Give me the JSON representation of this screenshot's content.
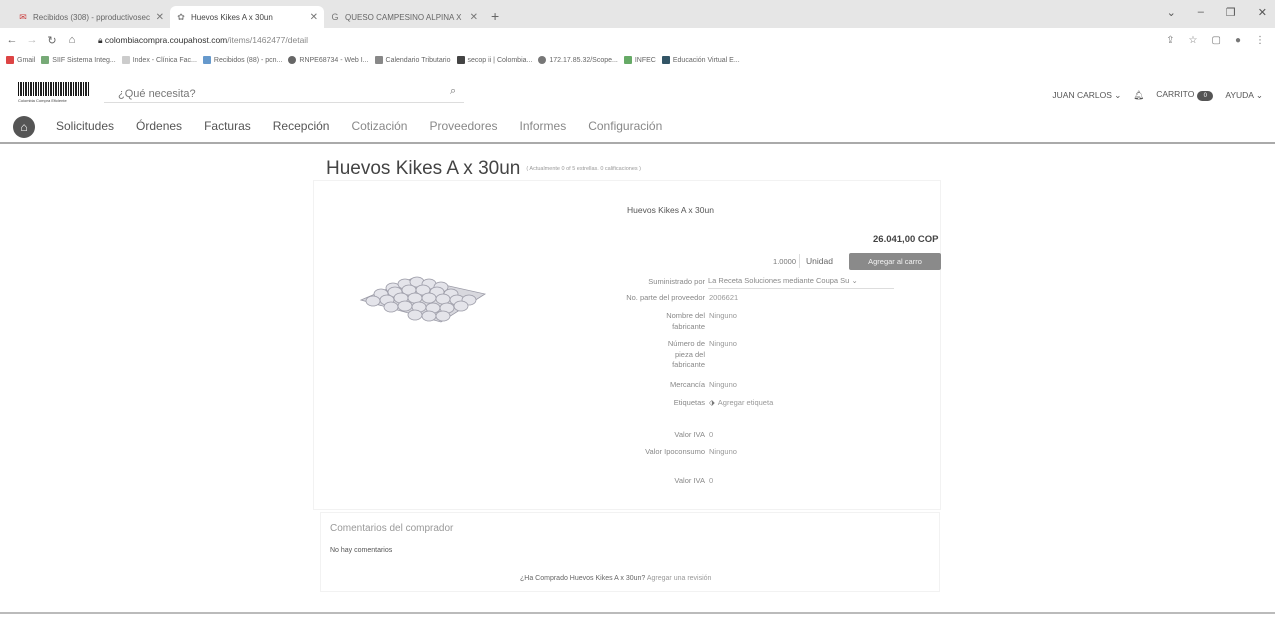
{
  "browser": {
    "tabs": [
      {
        "label": "Recibidos (308) - pproductivosec",
        "icon": "mail-icon"
      },
      {
        "label": "Huevos Kikes A x 30un",
        "icon": "coupa-icon"
      },
      {
        "label": "QUESO CAMPESINO ALPINA X",
        "icon": "google-icon"
      }
    ],
    "new_tab": "+",
    "url_host": "colombiacompra.coupahost.com",
    "url_path": "/items/1462477/detail",
    "bookmarks": [
      {
        "label": "Gmail",
        "color": "#d44"
      },
      {
        "label": "SIIF Sistema Integ...",
        "color": "#7a7"
      },
      {
        "label": "Index - Clínica Fac...",
        "color": "#aaa"
      },
      {
        "label": "Recibidos (88) - pcn...",
        "color": "#69c"
      },
      {
        "label": "RNPE68734 - Web I...",
        "color": "#666"
      },
      {
        "label": "Calendario Tributario",
        "color": "#888"
      },
      {
        "label": "secop ii | Colombia...",
        "color": "#444"
      },
      {
        "label": "172.17.85.32/Scope...",
        "color": "#777"
      },
      {
        "label": "INFEC",
        "color": "#6a6"
      },
      {
        "label": "Educación Virtual E...",
        "color": "#356"
      }
    ]
  },
  "header": {
    "logo_caption": "Colombia Compra Eficiente",
    "search_placeholder": "¿Qué necesita?",
    "user": "JUAN CARLOS",
    "cart": "CARRITO",
    "cart_count": "0",
    "help": "AYUDA"
  },
  "nav": {
    "items": [
      "Solicitudes",
      "Órdenes",
      "Facturas",
      "Recepción",
      "Cotización",
      "Proveedores",
      "Informes",
      "Configuración"
    ]
  },
  "product": {
    "title": "Huevos Kikes A x 30un",
    "rating_note": "( Actualmente 0 of 5 estrellas. 0 calificaciones )",
    "name": "Huevos Kikes A x 30un",
    "price": "26.041,00 COP",
    "quantity": "1.0000",
    "uom": "Unidad",
    "add_to_cart": "Agregar al carro",
    "specs": {
      "supplier_label": "Suministrado por",
      "supplier_value": "La Receta Soluciones mediante Coupa Su",
      "part_label": "No. parte del proveedor",
      "part_value": "2006621",
      "manufacturer_label": "Nombre del fabricante",
      "manufacturer_value": "Ninguno",
      "mfg_part_label": "Número de pieza del fabricante",
      "mfg_part_value": "Ninguno",
      "commodity_label": "Mercancía",
      "commodity_value": "Ninguno",
      "tags_label": "Etiquetas",
      "tags_value": "Agregar etiqueta",
      "iva_label": "Valor IVA",
      "iva_value": "0",
      "ipoconsumo_label": "Valor Ipoconsumo",
      "ipoconsumo_value": "Ninguno",
      "iva2_label": "Valor IVA",
      "iva2_value": "0"
    }
  },
  "comments": {
    "title": "Comentarios del comprador",
    "empty": "No hay comentarios",
    "review_question": "¿Ha Comprado Huevos Kikes A x 30un?",
    "review_link": "Agregar una revisión"
  }
}
